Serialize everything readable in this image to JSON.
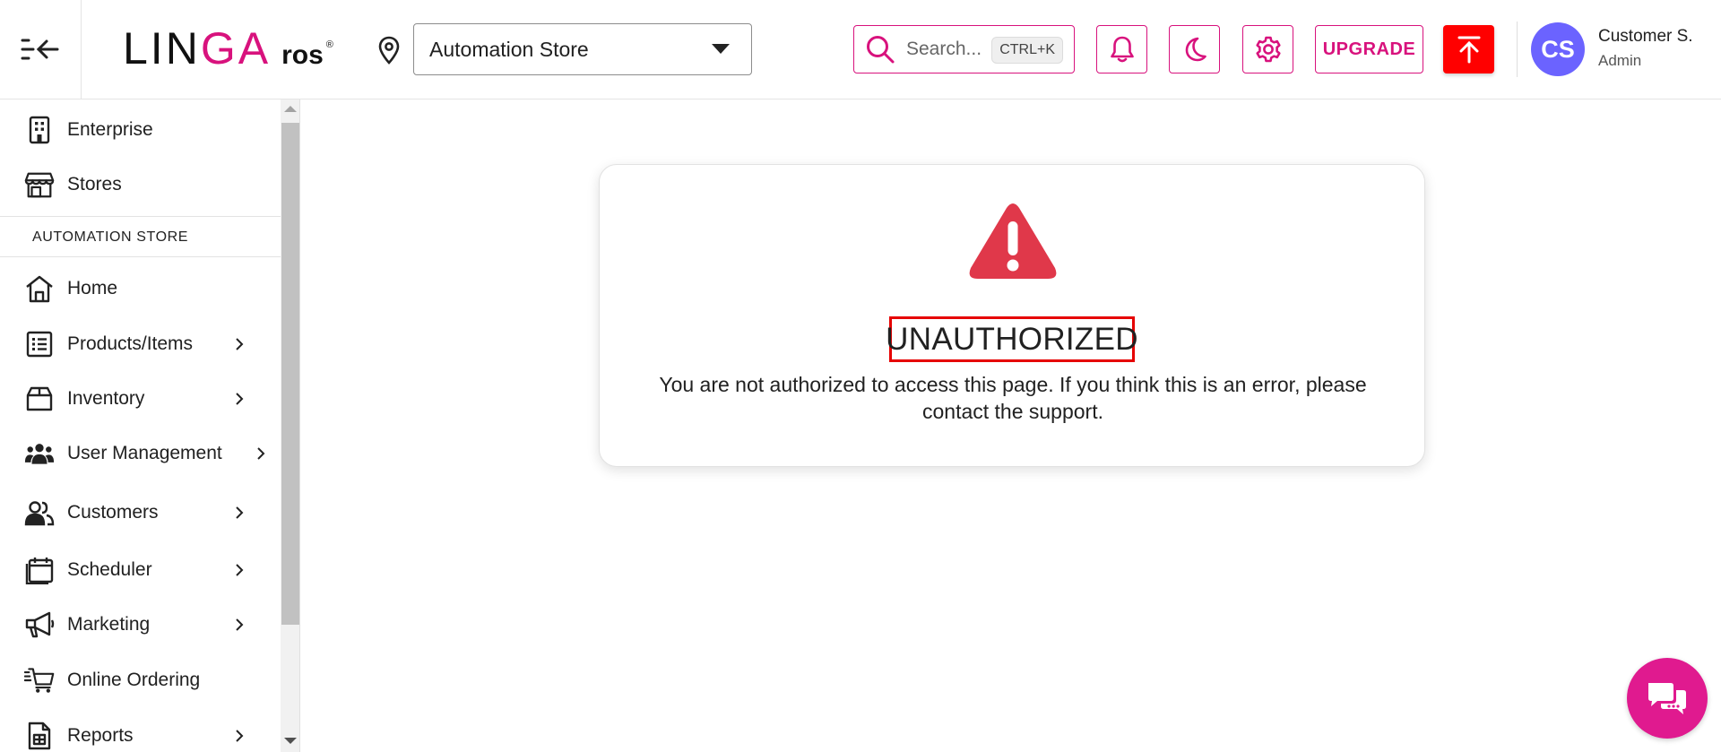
{
  "header": {
    "logo": {
      "part1": "LIN",
      "part2": "GA",
      "part3": "ros",
      "reg": "®"
    },
    "store_selector": {
      "value": "Automation Store"
    },
    "search": {
      "placeholder": "Search...",
      "shortcut": "CTRL+K"
    },
    "upgrade_label": "UPGRADE",
    "user": {
      "initials": "CS",
      "name": "Customer S.",
      "role": "Admin"
    },
    "icons": [
      "menu-collapse-icon",
      "location-pin-icon",
      "search-icon",
      "bell-icon",
      "moon-icon",
      "gear-icon",
      "upload-icon"
    ]
  },
  "sidebar": {
    "top_items": [
      {
        "label": "Enterprise",
        "icon": "building-icon"
      },
      {
        "label": "Stores",
        "icon": "store-icon"
      }
    ],
    "section_label": "AUTOMATION STORE",
    "items": [
      {
        "label": "Home",
        "icon": "home-icon",
        "has_children": false
      },
      {
        "label": "Products/Items",
        "icon": "list-icon",
        "has_children": true
      },
      {
        "label": "Inventory",
        "icon": "box-icon",
        "has_children": true
      },
      {
        "label": "User Management",
        "icon": "users-icon",
        "has_children": true
      },
      {
        "label": "Customers",
        "icon": "customers-icon",
        "has_children": true
      },
      {
        "label": "Scheduler",
        "icon": "calendar-icon",
        "has_children": true
      },
      {
        "label": "Marketing",
        "icon": "megaphone-icon",
        "has_children": true
      },
      {
        "label": "Online Ordering",
        "icon": "cart-icon",
        "has_children": false
      },
      {
        "label": "Reports",
        "icon": "report-icon",
        "has_children": true
      }
    ]
  },
  "error": {
    "title": "UNAUTHORIZED",
    "message": "You are not authorized to access this page. If you think this is an error, please contact the support."
  },
  "colors": {
    "brand": "#d8127d",
    "danger": "#e0384a",
    "upload_button": "#ff0000",
    "avatar": "#6b63ff",
    "chat_button": "#e01a8f",
    "highlight_border": "#e60000"
  }
}
